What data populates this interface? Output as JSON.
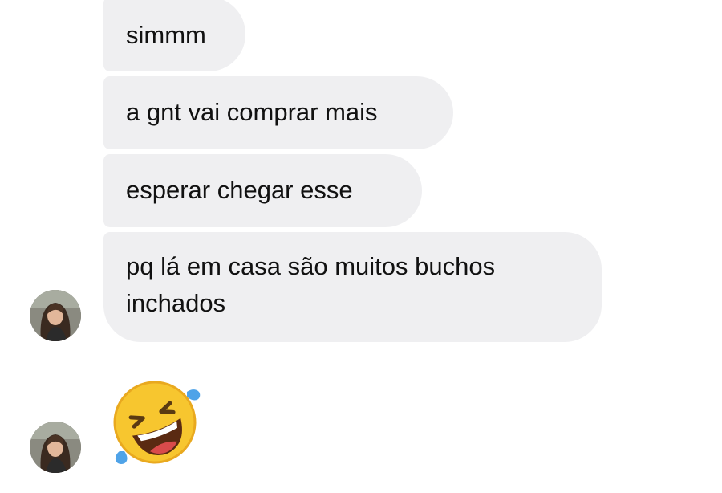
{
  "conversation": {
    "messages": [
      {
        "text": "simmm"
      },
      {
        "text": "a gnt vai comprar mais"
      },
      {
        "text": "esperar chegar esse"
      },
      {
        "text": "pq lá em casa são muitos buchos inchados"
      }
    ],
    "reaction": {
      "icon": "rolling-on-floor-laughing-emoji"
    }
  },
  "colors": {
    "bubble": "#efeff1",
    "text": "#111111",
    "background": "#ffffff",
    "emoji_face": "#f7c62f",
    "emoji_tear": "#4fa3e8"
  }
}
